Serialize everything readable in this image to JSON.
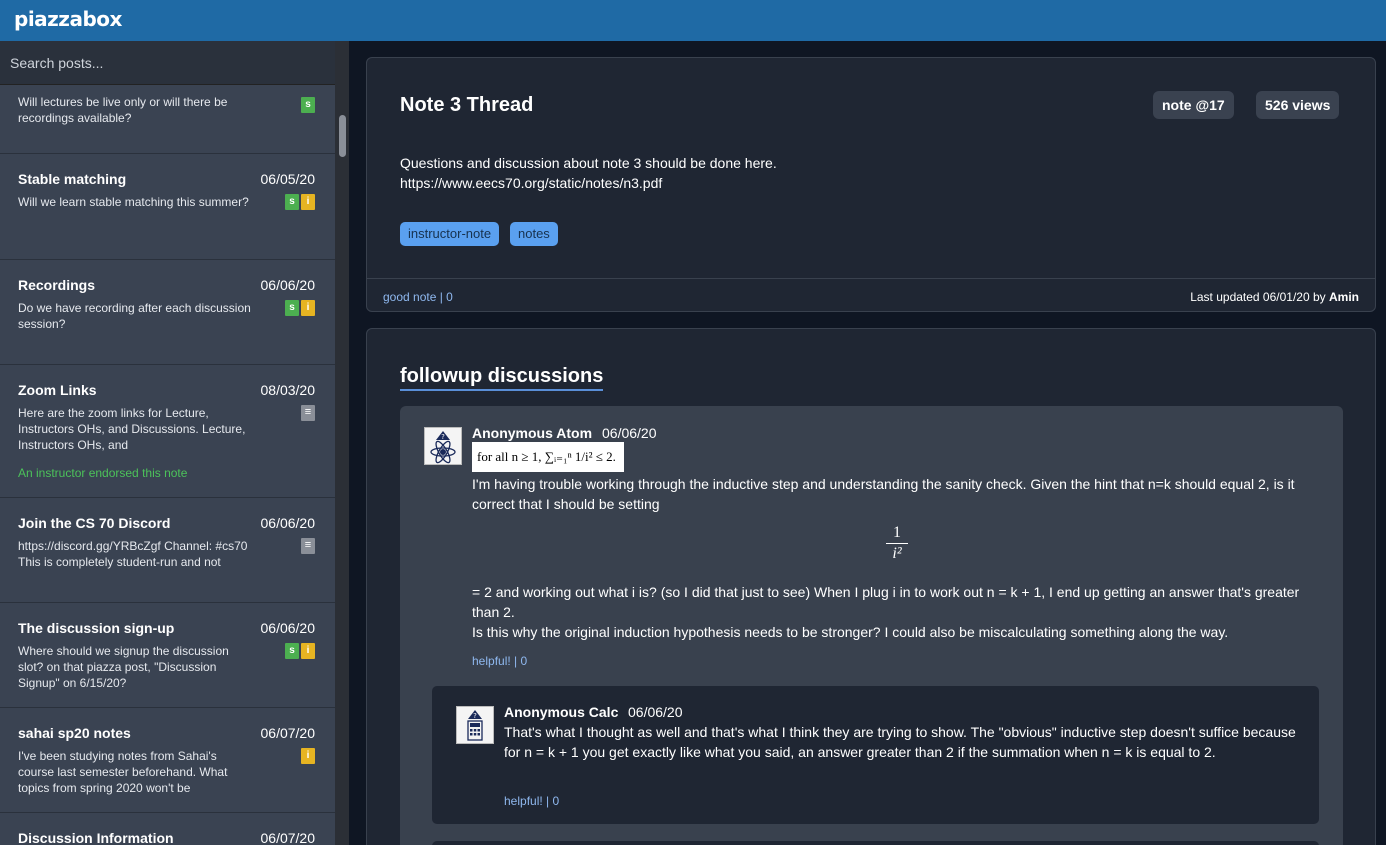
{
  "app": {
    "logo": "piazzabox"
  },
  "search": {
    "placeholder": "Search posts..."
  },
  "posts": [
    {
      "title": "",
      "date": "",
      "snippet": "Will lectures be live only or will there be recordings available?",
      "badges": [
        "s"
      ]
    },
    {
      "title": "Stable matching",
      "date": "06/05/20",
      "snippet": "Will we learn stable matching this summer?",
      "badges": [
        "s",
        "i"
      ]
    },
    {
      "title": "Recordings",
      "date": "06/06/20",
      "snippet": "Do we have recording after each discussion session?",
      "badges": [
        "s",
        "i"
      ]
    },
    {
      "title": "Zoom Links",
      "date": "08/03/20",
      "snippet": "Here are the zoom links for Lecture, Instructors OHs, and Discussions. Lecture, Instructors OHs, and",
      "badges": [
        "n"
      ],
      "endorsed": "An instructor endorsed this note"
    },
    {
      "title": "Join the CS 70 Discord",
      "date": "06/06/20",
      "snippet": "https://discord.gg/YRBcZgf Channel: #cs70 This is completely student-run and not",
      "badges": [
        "n"
      ]
    },
    {
      "title": "The discussion sign-up",
      "date": "06/06/20",
      "snippet": "Where should we signup the discussion slot? on that piazza post, \"Discussion Signup\" on 6/15/20?",
      "badges": [
        "s",
        "i"
      ]
    },
    {
      "title": "sahai sp20 notes",
      "date": "06/07/20",
      "snippet": "I've been studying notes from Sahai's course last semester beforehand. What topics from spring 2020 won't be",
      "badges": [
        "i"
      ]
    },
    {
      "title": "Discussion Information",
      "date": "06/07/20",
      "snippet": "",
      "badges": []
    }
  ],
  "note": {
    "title": "Note 3 Thread",
    "number": "note @17",
    "views": "526 views",
    "body_line1": "Questions and discussion about note 3 should be done here.",
    "body_line2": "https://www.eecs70.org/static/notes/n3.pdf",
    "tags": [
      "instructor-note",
      "notes"
    ],
    "good_note": "good note | 0",
    "updated_prefix": "Last updated 06/01/20 by",
    "updated_by": "Amin"
  },
  "followups": {
    "title": "followup discussions",
    "main": {
      "author": "Anonymous Atom",
      "date": "06/06/20",
      "math_image": "for all n ≥ 1, ∑ᵢ₌₁ⁿ 1/i² ≤ 2.",
      "body1": "I'm having trouble working through the inductive step and understanding the sanity check. Given the hint that n=k should equal 2, is it correct that I should be setting",
      "frac_num": "1",
      "frac_den": "i²",
      "body2": "= 2 and working out what i is? (so I did that just to see) When I plug i in to work out n = k + 1, I end up getting an answer that's greater than 2.",
      "body3": "Is this why the original induction hypothesis needs to be stronger? I could also be miscalculating something along the way.",
      "helpful": "helpful! | 0"
    },
    "reply": {
      "author": "Anonymous Calc",
      "date": "06/06/20",
      "body": "That's what I thought as well and that's what I think they are trying to show. The \"obvious\" inductive step doesn't suffice because for n = k + 1 you get exactly like what you said, an answer greater than 2 if the summation when n = k is equal to 2.",
      "helpful": "helpful! | 0"
    }
  }
}
